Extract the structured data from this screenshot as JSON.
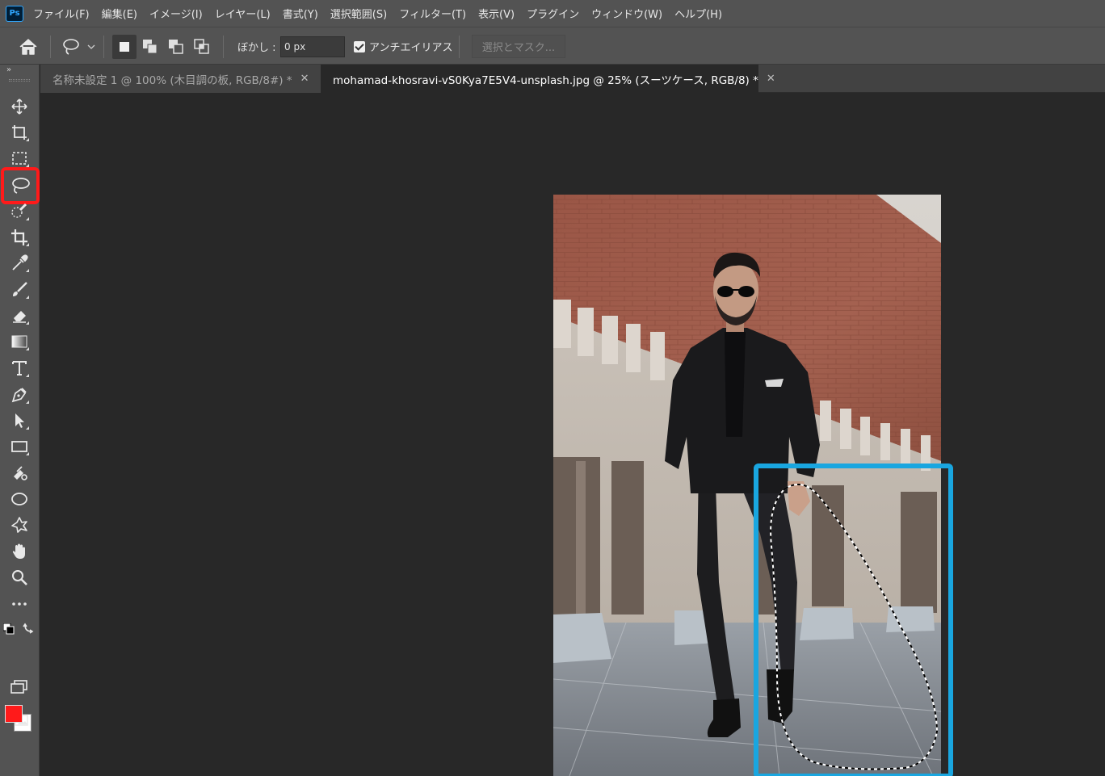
{
  "app": {
    "logo": "Ps"
  },
  "menu": [
    "ファイル(F)",
    "編集(E)",
    "イメージ(I)",
    "レイヤー(L)",
    "書式(Y)",
    "選択範囲(S)",
    "フィルター(T)",
    "表示(V)",
    "プラグイン",
    "ウィンドウ(W)",
    "ヘルプ(H)"
  ],
  "options": {
    "feather_label": "ぼかし :",
    "feather_value": "0 px",
    "antialias_label": "アンチエイリアス",
    "antialias_checked": true,
    "select_mask_button": "選択とマスク..."
  },
  "tabs": [
    {
      "label": "名称未設定 1 @ 100% (木目調の板, RGB/8#) *",
      "active": false
    },
    {
      "label": "mohamad-khosravi-vS0Kya7E5V4-unsplash.jpg @ 25% (スーツケース, RGB/8) *",
      "active": true
    }
  ],
  "toolbar": {
    "tools": [
      "move-icon",
      "artboard-icon",
      "marquee-icon",
      "lasso-icon",
      "quick-selection-icon",
      "crop-icon",
      "eyedropper-icon",
      "brush-icon",
      "eraser-icon",
      "gradient-icon",
      "type-icon",
      "pen-icon",
      "path-selection-icon",
      "rectangle-icon",
      "paint-bucket-icon",
      "ellipse-icon",
      "custom-shape-icon",
      "hand-icon",
      "zoom-icon",
      "more-tools-icon"
    ],
    "active_tool": "lasso-icon",
    "foreground_color": "#ff1a1a",
    "background_color": "#ffffff"
  },
  "annotations": {
    "tool_highlight_color": "#ff1a1a",
    "selection_highlight_color": "#19a6e0"
  }
}
